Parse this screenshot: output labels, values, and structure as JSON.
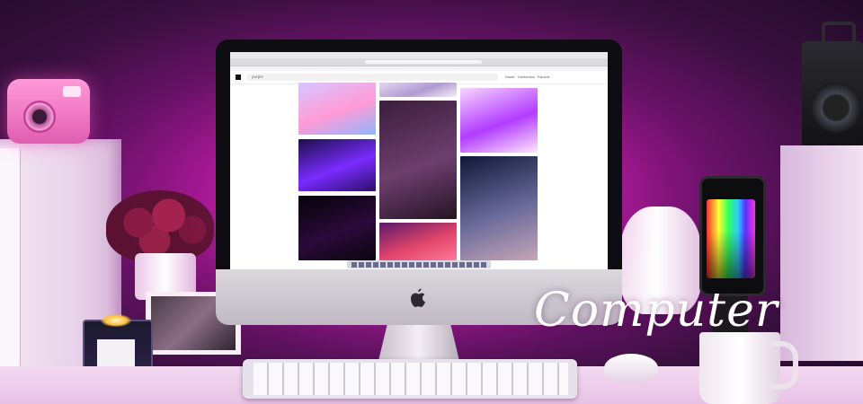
{
  "caption": "Computer",
  "screen": {
    "site_search_text": "purple",
    "banner_text": "",
    "nav_labels": "Home · Collections · Explore"
  },
  "tiles": [
    {
      "name": "tile-smoke-pastel",
      "c1": "#d8c6ff",
      "c2": "#ff9ad6",
      "c3": "#8fb7ff"
    },
    {
      "name": "tile-leaves-dark",
      "c1": "#3a1e3a",
      "c2": "#6d3f6d",
      "c3": "#241424"
    },
    {
      "name": "tile-purple-ink",
      "c1": "#f7d6ff",
      "c2": "#b23cff",
      "c3": "#ffe6ff"
    },
    {
      "name": "tile-violet-lights",
      "c1": "#1b0f4a",
      "c2": "#7a2bff",
      "c3": "#2a0f6a"
    },
    {
      "name": "tile-freedom-neon",
      "c1": "#050308",
      "c2": "#2a0a3a",
      "c3": "#0b0510"
    },
    {
      "name": "tile-night-lake",
      "c1": "#0f1738",
      "c2": "#6a6a9a",
      "c3": "#c7a6b8"
    },
    {
      "name": "tile-magenta-sky",
      "c1": "#5a1a6a",
      "c2": "#e0446a",
      "c3": "#ff7a9a"
    },
    {
      "name": "tile-top-smoke",
      "c1": "#e6d8f2",
      "c2": "#b09ad0",
      "c3": "#f4eef8"
    }
  ],
  "colors": {
    "ambient": "#ff2fd8",
    "desk": "#f3d9f0"
  },
  "icons": [
    "apple-logo-icon",
    "search-icon"
  ]
}
